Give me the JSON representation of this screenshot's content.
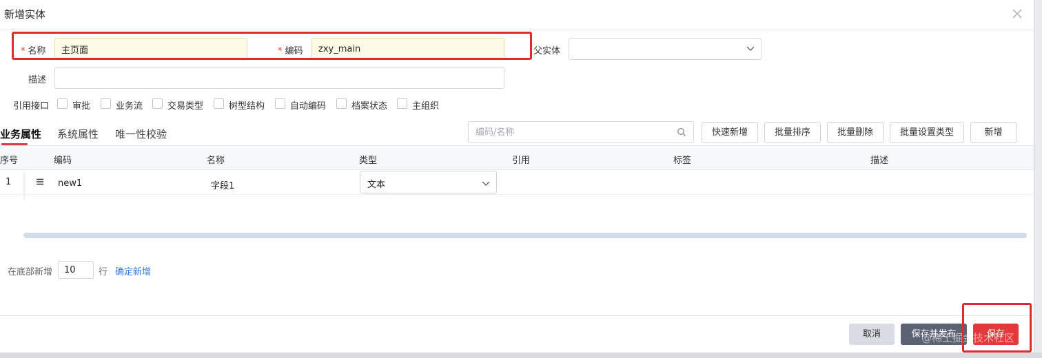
{
  "dialog": {
    "title": "新增实体"
  },
  "form": {
    "name": {
      "label": "名称",
      "value": "主页面"
    },
    "code": {
      "label": "编码",
      "value": "zxy_main"
    },
    "parent": {
      "label": "父实体",
      "value": ""
    },
    "desc": {
      "label": "描述",
      "value": ""
    },
    "required_mark": "*"
  },
  "interfaces": {
    "label": "引用接口",
    "items": [
      "审批",
      "业务流",
      "交易类型",
      "树型结构",
      "自动编码",
      "档案状态",
      "主组织"
    ]
  },
  "tabs": [
    "业务属性",
    "系统属性",
    "唯一性校验"
  ],
  "toolbar": {
    "search_placeholder": "编码/名称",
    "buttons": [
      "快速新增",
      "批量排序",
      "批量删除",
      "批量设置类型",
      "新增"
    ]
  },
  "table": {
    "columns": [
      "序号",
      "编码",
      "名称",
      "类型",
      "引用",
      "标签",
      "描述"
    ],
    "rows": [
      {
        "index": "1",
        "code": "new1",
        "name": "字段1",
        "type": "文本"
      }
    ]
  },
  "footer_add": {
    "prefix": "在底部新增",
    "count": "10",
    "suffix": "行",
    "confirm": "确定新增"
  },
  "actions": {
    "cancel": "取消",
    "publish": "保存并发布",
    "save": "保存"
  },
  "watermark": "@稀土掘金技术社区",
  "colors": {
    "primary": "#e4393c",
    "highlight_box": "#e12b2b",
    "publish": "#5b6272",
    "link": "#3b78e7"
  }
}
